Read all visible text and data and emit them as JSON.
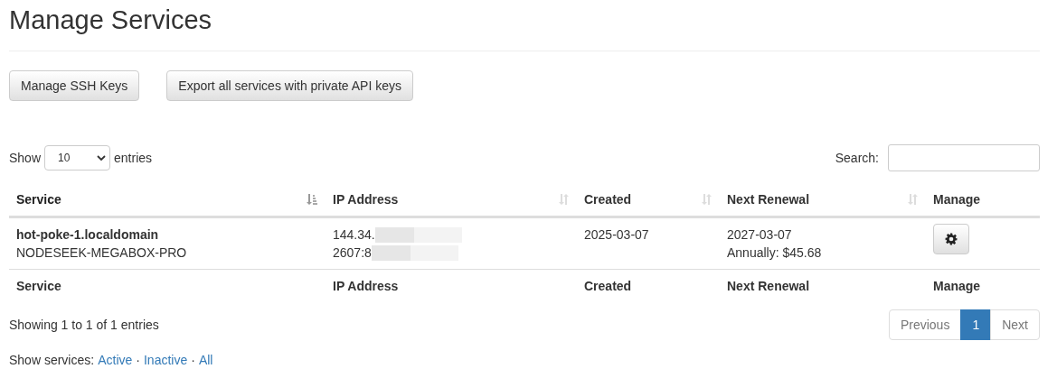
{
  "title": "Manage Services",
  "actions": [
    "Manage SSH Keys",
    "Export all services with private API keys"
  ],
  "length": {
    "label_before": "Show",
    "value": "10",
    "label_after": "entries"
  },
  "search": {
    "label": "Search:"
  },
  "table": {
    "columns": [
      {
        "label": "Service",
        "sortable": true,
        "sorted": true
      },
      {
        "label": "IP Address",
        "sortable": true,
        "sorted": false
      },
      {
        "label": "Created",
        "sortable": true,
        "sorted": false
      },
      {
        "label": "Next Renewal",
        "sortable": true,
        "sorted": false
      },
      {
        "label": "Manage",
        "sortable": false,
        "sorted": false
      }
    ],
    "footer": [
      "Service",
      "IP Address",
      "Created",
      "Next Renewal",
      "Manage"
    ],
    "rows": [
      {
        "service": "hot-poke-1.localdomain",
        "product": "NODESEEK-MEGABOX-PRO",
        "ips": [
          "144.34.",
          "2607:8"
        ],
        "created": "2025-03-07",
        "renewal": "2027-03-07",
        "billing": "Annually: $45.68"
      }
    ]
  },
  "info": "Showing 1 to 1 of 1 entries",
  "pagination": [
    {
      "label": "Previous",
      "disabled": true,
      "selected": false
    },
    {
      "label": "1",
      "disabled": false,
      "selected": true
    },
    {
      "label": "Next",
      "disabled": true,
      "selected": false
    }
  ],
  "filter": {
    "label": "Show services:",
    "links": [
      "Active",
      "Inactive",
      "All"
    ],
    "separator": "·"
  }
}
